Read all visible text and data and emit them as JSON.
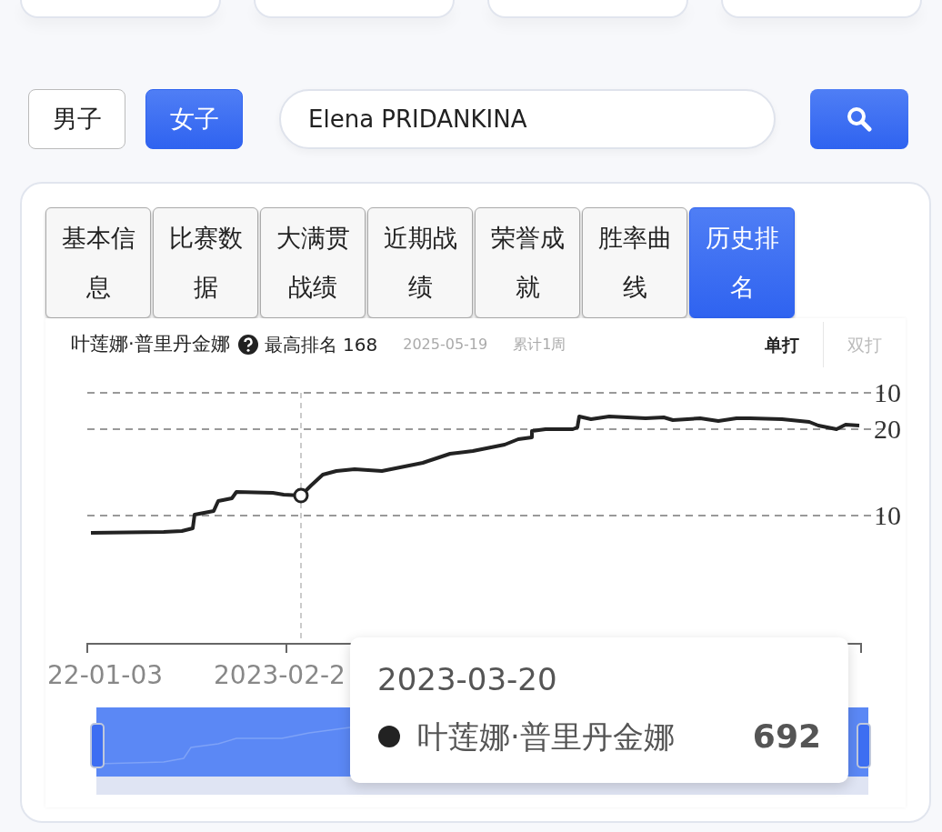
{
  "gender_filter": [
    {
      "label": "男子",
      "selected": false
    },
    {
      "label": "女子",
      "selected": true
    }
  ],
  "search": {
    "value": "Elena PRIDANKINA"
  },
  "tabs": [
    {
      "label": "基本信息",
      "selected": false
    },
    {
      "label": "比赛数据",
      "selected": false
    },
    {
      "label": "大满贯战绩",
      "selected": false
    },
    {
      "label": "近期战绩",
      "selected": false
    },
    {
      "label": "荣誉成就",
      "selected": false
    },
    {
      "label": "胜率曲线",
      "selected": false
    },
    {
      "label": "历史排名",
      "selected": true
    }
  ],
  "chart_header": {
    "player": "叶莲娜·普里丹金娜",
    "best_rank": "最高排名 168",
    "date": "2025-05-19",
    "duration": "累计1周",
    "modes": [
      {
        "label": "单打",
        "selected": true
      },
      {
        "label": "双打",
        "selected": false
      }
    ]
  },
  "y_axis_labels": [
    "10",
    "20",
    "10"
  ],
  "x_axis_labels": [
    "22-01-03",
    "2023-02-2"
  ],
  "range_slider": {
    "level": 1
  },
  "tooltip": {
    "date": "2023-03-20",
    "series": "叶莲娜·普里丹金娜",
    "value": "692"
  }
}
